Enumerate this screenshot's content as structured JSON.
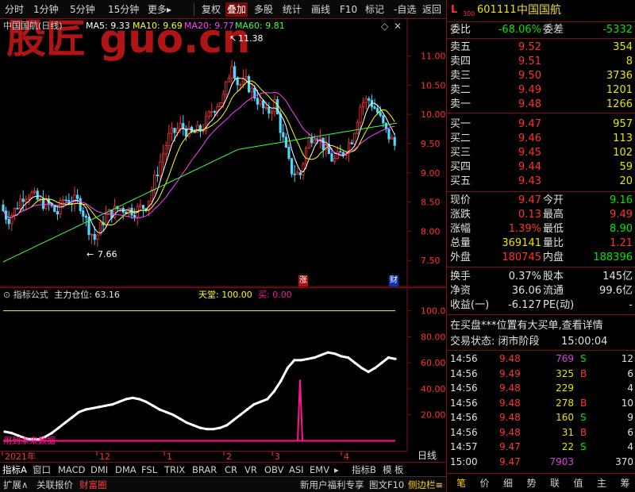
{
  "toolbar": {
    "left_items": [
      "分时",
      "1分钟",
      "5分钟",
      "15分钟",
      "更多"
    ],
    "more_arrow": "▸",
    "right_items": [
      "复权",
      "叠加",
      "多股",
      "统计",
      "画线",
      "F10",
      "标记",
      "-自选",
      "返回"
    ],
    "active": "叠加"
  },
  "main": {
    "title": "中国国航(日线)",
    "ma5": "MA5: 9.33",
    "ma10": "MA10: 9.69",
    "ma20": "MA20: 9.77",
    "ma60": "MA60: 9.81",
    "high_label": "11.38",
    "low_label": "7.66",
    "watermark": "股匠 guo.cn",
    "badge_zhang": "涨",
    "badge_cai": "财",
    "y_ticks": [
      "11.00",
      "10.50",
      "10.00",
      "9.50",
      "9.00",
      "8.50",
      "8.00",
      "7.50"
    ],
    "colors": {
      "up": "#ff3232",
      "down": "#4fd8ff",
      "ma5": "#ffffff",
      "ma10": "#ffff00",
      "ma20": "#ff40ff",
      "ma60": "#40ff40"
    }
  },
  "indicator": {
    "title": "指标公式",
    "position": "主力仓位: 63.16",
    "tiantang": "天堂: 100.00",
    "mai": "买: 0.00",
    "bottom_text": "用到未来数据",
    "y_ticks": [
      "100.0",
      "80.00",
      "60.00",
      "40.00",
      "20.00"
    ],
    "spike_value": 47,
    "colors": {
      "line": "#ffffff",
      "tiantang": "#ffff00",
      "buy": "#ff1493"
    }
  },
  "chart_data": {
    "type": "line",
    "title": "",
    "xlabel": "",
    "ylabel": "",
    "x_tick_labels": [
      "2021年",
      "12",
      "1",
      "2",
      "3",
      "4"
    ],
    "series": [
      {
        "name": "主力仓位",
        "values": [
          7,
          6,
          4,
          2,
          1,
          1,
          3,
          6,
          10,
          14,
          18,
          22,
          24,
          25,
          26,
          27,
          28,
          30,
          32,
          33,
          32,
          30,
          27,
          24,
          22,
          20,
          17,
          14,
          12,
          10,
          9,
          9,
          10,
          12,
          16,
          20,
          24,
          28,
          30,
          32,
          38,
          46,
          56,
          62,
          62,
          63,
          64,
          66,
          68,
          67,
          65,
          64,
          60,
          56,
          53,
          56,
          60,
          64,
          63
        ]
      }
    ],
    "ylim": [
      0,
      100
    ],
    "grid": false,
    "legend": "none"
  },
  "range_label": "日线",
  "tabbar": {
    "items": [
      "指标A",
      "窗口",
      "MACD",
      "DMI",
      "DMA",
      "FSL",
      "TRIX",
      "BRAR",
      "CR",
      "VR",
      "OBV",
      "ASI",
      "EMV"
    ],
    "more": "▸",
    "right_items": [
      "指标B",
      "模",
      "板"
    ]
  },
  "statusbar": {
    "left_items": [
      "扩展∧",
      "关联报价",
      "财富圈"
    ],
    "right_items": [
      "新用户福利专享",
      "图文F10",
      "侧边栏≡"
    ]
  },
  "quote": {
    "header_l": "L",
    "header_num": "300",
    "code": "601111",
    "name": "中国国航",
    "weibi_label": "委比",
    "weibi_value": "-68.06%",
    "weicha_label": "委差",
    "weicha_value": "-5332",
    "asks": [
      {
        "label": "卖五",
        "price": "9.52",
        "vol": "354"
      },
      {
        "label": "卖四",
        "price": "9.51",
        "vol": "8"
      },
      {
        "label": "卖三",
        "price": "9.50",
        "vol": "3736"
      },
      {
        "label": "卖二",
        "price": "9.49",
        "vol": "1201"
      },
      {
        "label": "卖一",
        "price": "9.48",
        "vol": "1266"
      }
    ],
    "bids": [
      {
        "label": "买一",
        "price": "9.47",
        "vol": "957"
      },
      {
        "label": "买二",
        "price": "9.46",
        "vol": "113"
      },
      {
        "label": "买三",
        "price": "9.45",
        "vol": "102"
      },
      {
        "label": "买四",
        "price": "9.44",
        "vol": "59"
      },
      {
        "label": "买五",
        "price": "9.43",
        "vol": "20"
      }
    ],
    "stats": [
      {
        "l1": "现价",
        "v1": "9.47",
        "c1": "red",
        "l2": "今开",
        "v2": "9.16",
        "c2": "green"
      },
      {
        "l1": "涨跌",
        "v1": "0.13",
        "c1": "red",
        "l2": "最高",
        "v2": "9.49",
        "c2": "red"
      },
      {
        "l1": "涨幅",
        "v1": "1.39%",
        "c1": "red",
        "l2": "最低",
        "v2": "8.90",
        "c2": "green"
      },
      {
        "l1": "总量",
        "v1": "369141",
        "c1": "yellow",
        "l2": "量比",
        "v2": "1.21",
        "c2": "red"
      },
      {
        "l1": "外盘",
        "v1": "180745",
        "c1": "red",
        "l2": "内盘",
        "v2": "188396",
        "c2": "green"
      }
    ],
    "stats2": [
      {
        "l1": "换手",
        "v1": "0.37%",
        "l2": "股本",
        "v2": "145亿"
      },
      {
        "l1": "净资",
        "v1": "36.06",
        "l2": "流通",
        "v2": "99.6亿"
      },
      {
        "l1": "收益(一)",
        "v1": "-6.127",
        "l2": "PE(动)",
        "v2": "-"
      }
    ],
    "notice": "在买盘***位置有大买单,查看详情",
    "status_label": "交易状态: 闭市阶段",
    "status_time": "15:00:04",
    "ticks": [
      {
        "t": "14:56",
        "p": "9.48",
        "v": "769",
        "vc": "purple",
        "bs": "S",
        "bc": "green",
        "n": "12"
      },
      {
        "t": "14:56",
        "p": "9.49",
        "v": "325",
        "vc": "yellow",
        "bs": "B",
        "bc": "red",
        "n": "6"
      },
      {
        "t": "14:56",
        "p": "9.48",
        "v": "229",
        "vc": "yellow",
        "bs": "",
        "bc": "white",
        "n": "4"
      },
      {
        "t": "14:56",
        "p": "9.48",
        "v": "278",
        "vc": "yellow",
        "bs": "B",
        "bc": "red",
        "n": "10"
      },
      {
        "t": "14:56",
        "p": "9.48",
        "v": "160",
        "vc": "yellow",
        "bs": "S",
        "bc": "green",
        "n": "9"
      },
      {
        "t": "14:56",
        "p": "9.48",
        "v": "31",
        "vc": "yellow",
        "bs": "B",
        "bc": "red",
        "n": "6"
      },
      {
        "t": "14:57",
        "p": "9.47",
        "v": "22",
        "vc": "yellow",
        "bs": "S",
        "bc": "green",
        "n": "4"
      },
      {
        "t": "15:00",
        "p": "9.47",
        "v": "7903",
        "vc": "purple",
        "bs": "",
        "bc": "white",
        "n": "370"
      }
    ],
    "bottom_tabs": [
      "笔",
      "价",
      "细",
      "势",
      "联",
      "值",
      "主",
      "筹"
    ]
  }
}
